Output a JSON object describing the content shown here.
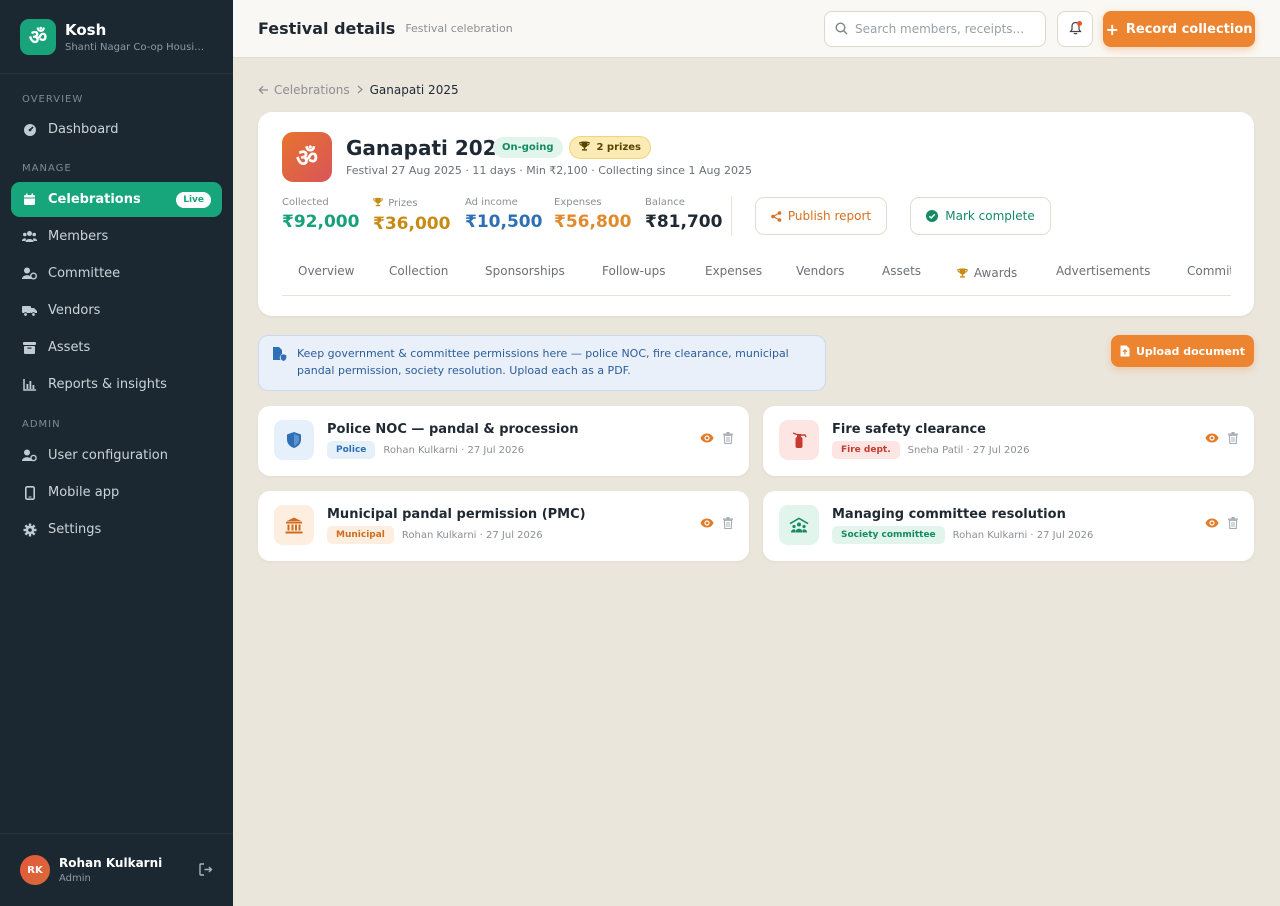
{
  "brand": {
    "name": "Kosh",
    "subtitle": "Shanti Nagar Co-op Housing Society",
    "logo_glyph": "ॐ",
    "color": "#19a37a"
  },
  "sidebar": {
    "sections": [
      {
        "label": "OVERVIEW",
        "items": [
          {
            "label": "Dashboard",
            "icon": "dashboard-icon"
          }
        ]
      },
      {
        "label": "MANAGE",
        "items": [
          {
            "label": "Celebrations",
            "icon": "calendar-icon",
            "active": true,
            "badge": "Live"
          },
          {
            "label": "Members",
            "icon": "users-icon"
          },
          {
            "label": "Committee",
            "icon": "committee-icon"
          },
          {
            "label": "Vendors",
            "icon": "truck-icon"
          },
          {
            "label": "Assets",
            "icon": "archive-icon"
          },
          {
            "label": "Reports & insights",
            "icon": "chart-icon"
          }
        ]
      },
      {
        "label": "ADMIN",
        "items": [
          {
            "label": "User configuration",
            "icon": "user-cog-icon"
          },
          {
            "label": "Mobile app",
            "icon": "mobile-icon"
          },
          {
            "label": "Settings",
            "icon": "gear-icon"
          }
        ]
      }
    ],
    "user": {
      "initials": "RK",
      "name": "Rohan Kulkarni",
      "role": "Admin"
    }
  },
  "topbar": {
    "title": "Festival details",
    "subtitle": "Festival celebration",
    "search_placeholder": "Search members, receipts...",
    "record_label": "Record collection"
  },
  "breadcrumb": {
    "parent": "Celebrations",
    "current": "Ganapati 2025"
  },
  "festival": {
    "logo_glyph": "ॐ",
    "name": "Ganapati 2025",
    "status": "On-going",
    "prizes_badge": "2 prizes",
    "meta": "Festival 27 Aug 2025 · 11 days · Min ₹2,100 · Collecting since 1 Aug 2025",
    "stats": [
      {
        "label": "Collected",
        "value": "₹92,000",
        "color": "#17a07a"
      },
      {
        "label": "Prizes",
        "value": "₹36,000",
        "color": "#c78a12",
        "icon": "trophy-icon"
      },
      {
        "label": "Ad income",
        "value": "₹10,500",
        "color": "#2e6fb5"
      },
      {
        "label": "Expenses",
        "value": "₹56,800",
        "color": "#e08a2c"
      },
      {
        "label": "Balance",
        "value": "₹81,700",
        "color": "#1f2933"
      }
    ],
    "publish_label": "Publish report",
    "complete_label": "Mark complete"
  },
  "tabs": [
    "Overview",
    "Collection",
    "Sponsorships",
    "Follow-ups",
    "Expenses",
    "Vendors",
    "Assets",
    "Awards",
    "Advertisements",
    "Committee"
  ],
  "info_text": "Keep government & committee permissions here — police NOC, fire clearance, municipal pandal permission, society resolution. Upload each as a PDF.",
  "upload_label": "Upload document",
  "documents": [
    {
      "title": "Police NOC — pandal & procession",
      "tag": "Police",
      "meta": "Rohan Kulkarni · 27 Jul 2026",
      "icon": "shield-icon",
      "tag_bg": "#e6f0fb",
      "tag_fg": "#2e6fb5",
      "icon_bg": "#e6f0fb"
    },
    {
      "title": "Fire safety clearance",
      "tag": "Fire dept.",
      "meta": "Sneha Patil · 27 Jul 2026",
      "icon": "fire-extinguisher-icon",
      "tag_bg": "#fde5e3",
      "tag_fg": "#c63a2f",
      "icon_bg": "#fde5e3"
    },
    {
      "title": "Municipal pandal permission (PMC)",
      "tag": "Municipal",
      "meta": "Rohan Kulkarni · 27 Jul 2026",
      "icon": "building-columns-icon",
      "tag_bg": "#fdeee0",
      "tag_fg": "#cf6d1f",
      "icon_bg": "#fdeee0"
    },
    {
      "title": "Managing committee resolution",
      "tag": "Society committee",
      "meta": "Rohan Kulkarni · 27 Jul 2026",
      "icon": "people-roof-icon",
      "tag_bg": "#e2f5ec",
      "tag_fg": "#158b62",
      "icon_bg": "#e2f5ec"
    }
  ]
}
